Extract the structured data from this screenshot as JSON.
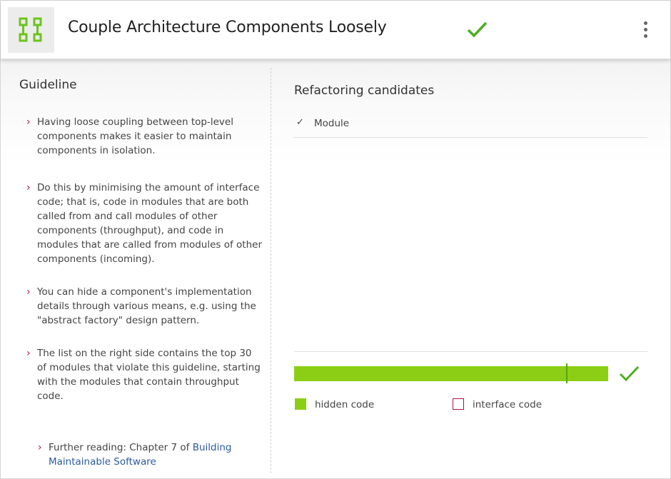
{
  "header": {
    "title": "Couple Architecture Components Loosely",
    "logo_icon": "components-grid-icon",
    "status_icon": "checkmark-icon",
    "menu_icon": "more-vertical-icon",
    "accent_color": "#8cce15",
    "status_color": "#4caf1f"
  },
  "guideline": {
    "heading": "Guideline",
    "bullets": [
      "Having loose coupling between top-level components makes it easier to maintain components in isolation.",
      "Do this by minimising the amount of interface code; that is, code in modules that are both called from and call modules of other components (throughput), and code in modules that are called from modules of other components (incoming).",
      "You can hide a component's implementation details through various means, e.g. using the \"abstract factory\" design pattern.",
      "The list on the right side contains the top 30 of modules that violate this guideline, starting with the modules that contain throughput code."
    ],
    "further_reading_prefix": "Further reading: Chapter 7 of ",
    "further_reading_link": "Building Maintainable Software",
    "bullet_color": "#b0104a"
  },
  "candidates": {
    "heading": "Refactoring candidates",
    "column_check": "✓",
    "column_label": "Module",
    "hidden_fraction": 0.865,
    "legend": {
      "hidden": "hidden code",
      "interface": "interface code"
    },
    "hidden_color": "#8cce15",
    "interface_color": "#b0104a"
  }
}
